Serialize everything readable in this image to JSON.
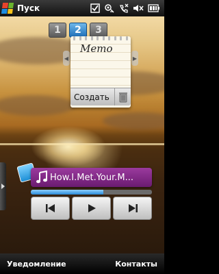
{
  "status_bar": {
    "start_label": "Пуск",
    "icons": [
      "checklist-icon",
      "connectivity-icon",
      "phone-missed-icon",
      "volume-muted-icon",
      "battery-icon"
    ]
  },
  "pager": {
    "pages": [
      "1",
      "2",
      "3"
    ],
    "active_index": 1
  },
  "memo_widget": {
    "title": "Memo",
    "create_label": "Создать",
    "trash_icon": "trash-icon"
  },
  "music_widget": {
    "track_title": "How.I.Met.Your.M...",
    "progress_fraction": 0.6,
    "buttons": [
      "previous-icon",
      "play-icon",
      "next-icon"
    ]
  },
  "softkeys": {
    "left": "Уведомление",
    "right": "Контакты"
  },
  "colors": {
    "active_tab": "#1e6fb8",
    "music_bar": "#8b2e90",
    "progress": "#2a8ad6"
  }
}
